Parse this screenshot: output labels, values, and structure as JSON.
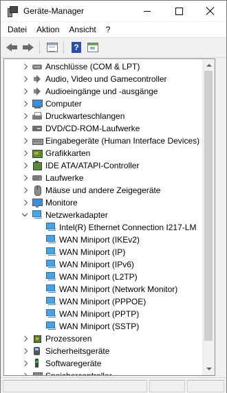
{
  "window": {
    "title": "Geräte-Manager",
    "icon": "device-manager-icon"
  },
  "menu": [
    "Datei",
    "Aktion",
    "Ansicht",
    "?"
  ],
  "toolbar": [
    "back-arrow-icon",
    "forward-arrow-icon",
    "properties-icon",
    "help-icon",
    "scan-hardware-icon"
  ],
  "tree": {
    "items": [
      {
        "label": "Anschlüsse (COM & LPT)",
        "level": 0,
        "expander": "collapsed",
        "icon": "port-icon"
      },
      {
        "label": "Audio, Video und Gamecontroller",
        "level": 0,
        "expander": "collapsed",
        "icon": "audio-icon"
      },
      {
        "label": "Audioeingänge und -ausgänge",
        "level": 0,
        "expander": "collapsed",
        "icon": "audio-icon"
      },
      {
        "label": "Computer",
        "level": 0,
        "expander": "collapsed",
        "icon": "computer-icon"
      },
      {
        "label": "Druckwarteschlangen",
        "level": 0,
        "expander": "collapsed",
        "icon": "printer-icon"
      },
      {
        "label": "DVD/CD-ROM-Laufwerke",
        "level": 0,
        "expander": "collapsed",
        "icon": "disc-drive-icon"
      },
      {
        "label": "Eingabegeräte (Human Interface Devices)",
        "level": 0,
        "expander": "collapsed",
        "icon": "hid-icon"
      },
      {
        "label": "Grafikkarten",
        "level": 0,
        "expander": "collapsed",
        "icon": "graphics-card-icon"
      },
      {
        "label": "IDE ATA/ATAPI-Controller",
        "level": 0,
        "expander": "collapsed",
        "icon": "ide-controller-icon"
      },
      {
        "label": "Laufwerke",
        "level": 0,
        "expander": "collapsed",
        "icon": "drive-icon"
      },
      {
        "label": "Mäuse und andere Zeigegeräte",
        "level": 0,
        "expander": "collapsed",
        "icon": "mouse-icon"
      },
      {
        "label": "Monitore",
        "level": 0,
        "expander": "collapsed",
        "icon": "monitor-icon"
      },
      {
        "label": "Netzwerkadapter",
        "level": 0,
        "expander": "expanded",
        "icon": "network-adapter-icon"
      },
      {
        "label": "Intel(R) Ethernet Connection I217-LM",
        "level": 1,
        "expander": "none",
        "icon": "network-adapter-icon"
      },
      {
        "label": "WAN Miniport (IKEv2)",
        "level": 1,
        "expander": "none",
        "icon": "network-adapter-icon"
      },
      {
        "label": "WAN Miniport (IP)",
        "level": 1,
        "expander": "none",
        "icon": "network-adapter-icon"
      },
      {
        "label": "WAN Miniport (IPv6)",
        "level": 1,
        "expander": "none",
        "icon": "network-adapter-icon"
      },
      {
        "label": "WAN Miniport (L2TP)",
        "level": 1,
        "expander": "none",
        "icon": "network-adapter-icon"
      },
      {
        "label": "WAN Miniport (Network Monitor)",
        "level": 1,
        "expander": "none",
        "icon": "network-adapter-icon"
      },
      {
        "label": "WAN Miniport (PPPOE)",
        "level": 1,
        "expander": "none",
        "icon": "network-adapter-icon"
      },
      {
        "label": "WAN Miniport (PPTP)",
        "level": 1,
        "expander": "none",
        "icon": "network-adapter-icon"
      },
      {
        "label": "WAN Miniport (SSTP)",
        "level": 1,
        "expander": "none",
        "icon": "network-adapter-icon"
      },
      {
        "label": "Prozessoren",
        "level": 0,
        "expander": "collapsed",
        "icon": "processor-icon"
      },
      {
        "label": "Sicherheitsgeräte",
        "level": 0,
        "expander": "collapsed",
        "icon": "security-device-icon"
      },
      {
        "label": "Softwaregeräte",
        "level": 0,
        "expander": "collapsed",
        "icon": "software-device-icon"
      },
      {
        "label": "Speichercontroller",
        "level": 0,
        "expander": "collapsed",
        "icon": "storage-controller-icon"
      }
    ]
  }
}
